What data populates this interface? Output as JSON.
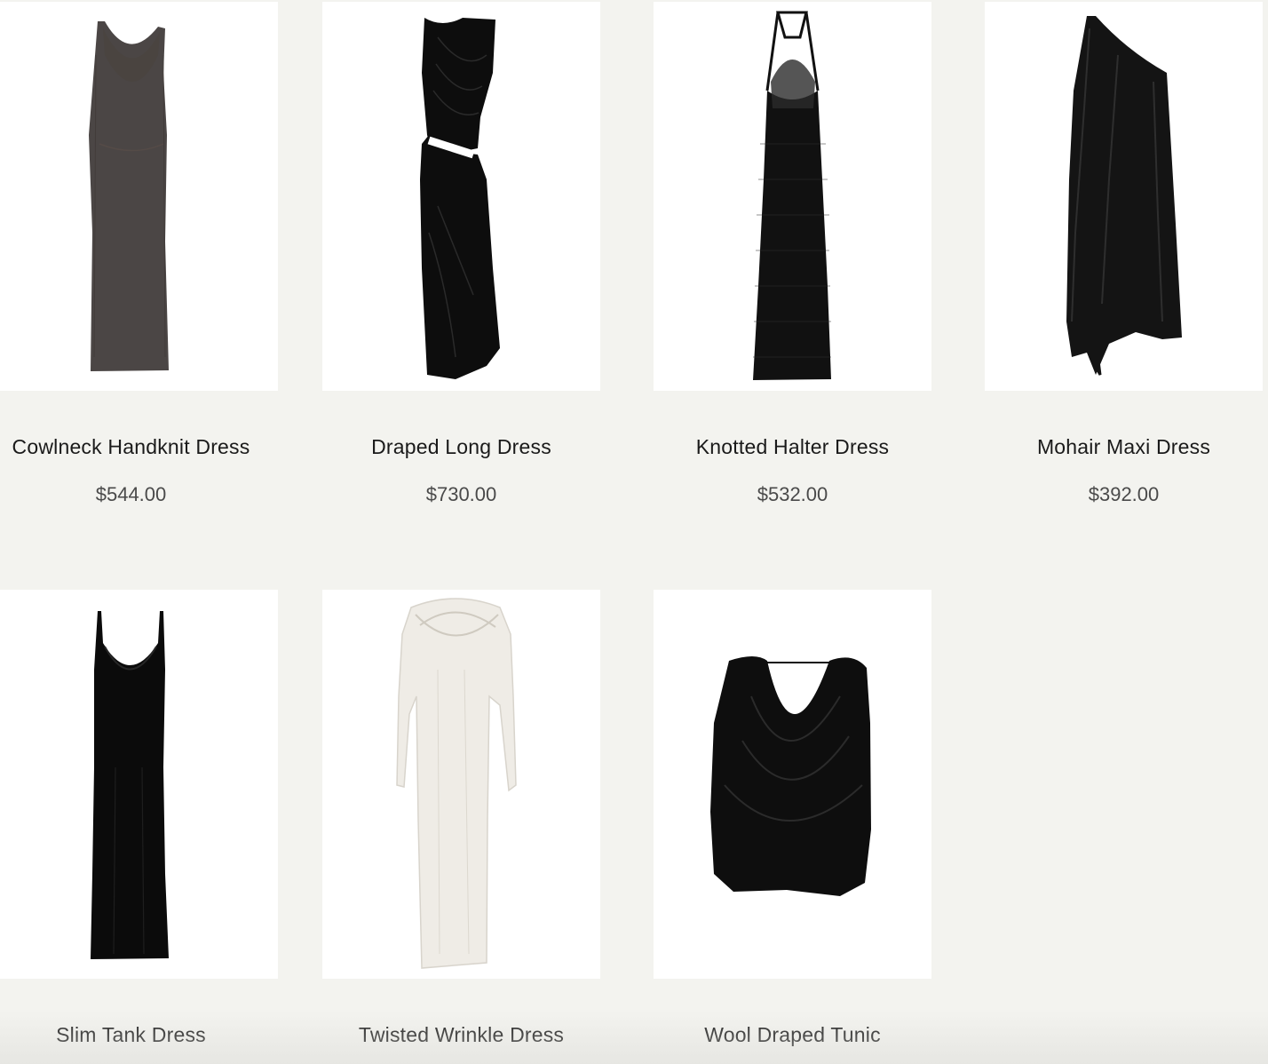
{
  "products": [
    {
      "name": "Cowlneck Handknit Dress",
      "price": "$544.00",
      "image_icon": "sheer-cowlneck-dress-image",
      "garment_color": "#2b2624"
    },
    {
      "name": "Draped Long Dress",
      "price": "$730.00",
      "image_icon": "draped-cutout-dress-image",
      "garment_color": "#0d0d0d"
    },
    {
      "name": "Knotted Halter Dress",
      "price": "$532.00",
      "image_icon": "mesh-halter-dress-image",
      "garment_color": "#111111"
    },
    {
      "name": "Mohair Maxi Dress",
      "price": "$392.00",
      "image_icon": "one-shoulder-dress-image",
      "garment_color": "#141414"
    },
    {
      "name": "Slim Tank Dress",
      "price": "",
      "image_icon": "slim-tank-dress-image",
      "garment_color": "#0b0b0b"
    },
    {
      "name": "Twisted Wrinkle Dress",
      "price": "",
      "image_icon": "white-long-sleeve-dress-image",
      "garment_color": "#efece6"
    },
    {
      "name": "Wool Draped Tunic",
      "price": "",
      "image_icon": "draped-tunic-image",
      "garment_color": "#0e0e0e"
    }
  ],
  "colors": {
    "page_background": "#f3f3ef",
    "card_background": "#ffffff",
    "title_text": "#1a1a1a",
    "price_text": "#4a4a4a"
  }
}
